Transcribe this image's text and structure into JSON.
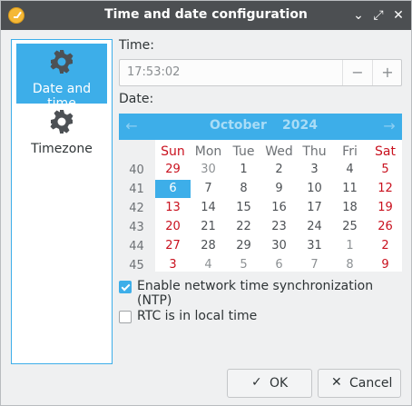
{
  "window": {
    "title": "Time and date configuration"
  },
  "sidebar": {
    "items": [
      {
        "label": "Date and time",
        "icon": "gear-icon",
        "active": true
      },
      {
        "label": "Timezone",
        "icon": "gear-icon",
        "active": false
      }
    ]
  },
  "form": {
    "time_label": "Time:",
    "time_value": "17:53:02",
    "minus": "−",
    "plus": "+",
    "date_label": "Date:"
  },
  "calendar": {
    "month": "October",
    "year": "2024",
    "prev": "←",
    "next": "→",
    "weekdays": [
      "Sun",
      "Mon",
      "Tue",
      "Wed",
      "Thu",
      "Fri",
      "Sat"
    ],
    "weeks": [
      {
        "num": "40",
        "days": [
          "29",
          "30",
          "1",
          "2",
          "3",
          "4",
          "5"
        ]
      },
      {
        "num": "41",
        "days": [
          "6",
          "7",
          "8",
          "9",
          "10",
          "11",
          "12"
        ]
      },
      {
        "num": "42",
        "days": [
          "13",
          "14",
          "15",
          "16",
          "17",
          "18",
          "19"
        ]
      },
      {
        "num": "43",
        "days": [
          "20",
          "21",
          "22",
          "23",
          "24",
          "25",
          "26"
        ]
      },
      {
        "num": "44",
        "days": [
          "27",
          "28",
          "29",
          "30",
          "31",
          "1",
          "2"
        ]
      },
      {
        "num": "45",
        "days": [
          "3",
          "4",
          "5",
          "6",
          "7",
          "8",
          "9"
        ]
      }
    ],
    "selected_day": "6",
    "accent": "#3daee9",
    "weekend_color": "#c9111e"
  },
  "options": {
    "ntp_label": "Enable network time synchronization (NTP)",
    "ntp_checked": true,
    "rtc_label": "RTC is in local time",
    "rtc_checked": false
  },
  "buttons": {
    "ok": "OK",
    "cancel": "Cancel"
  }
}
